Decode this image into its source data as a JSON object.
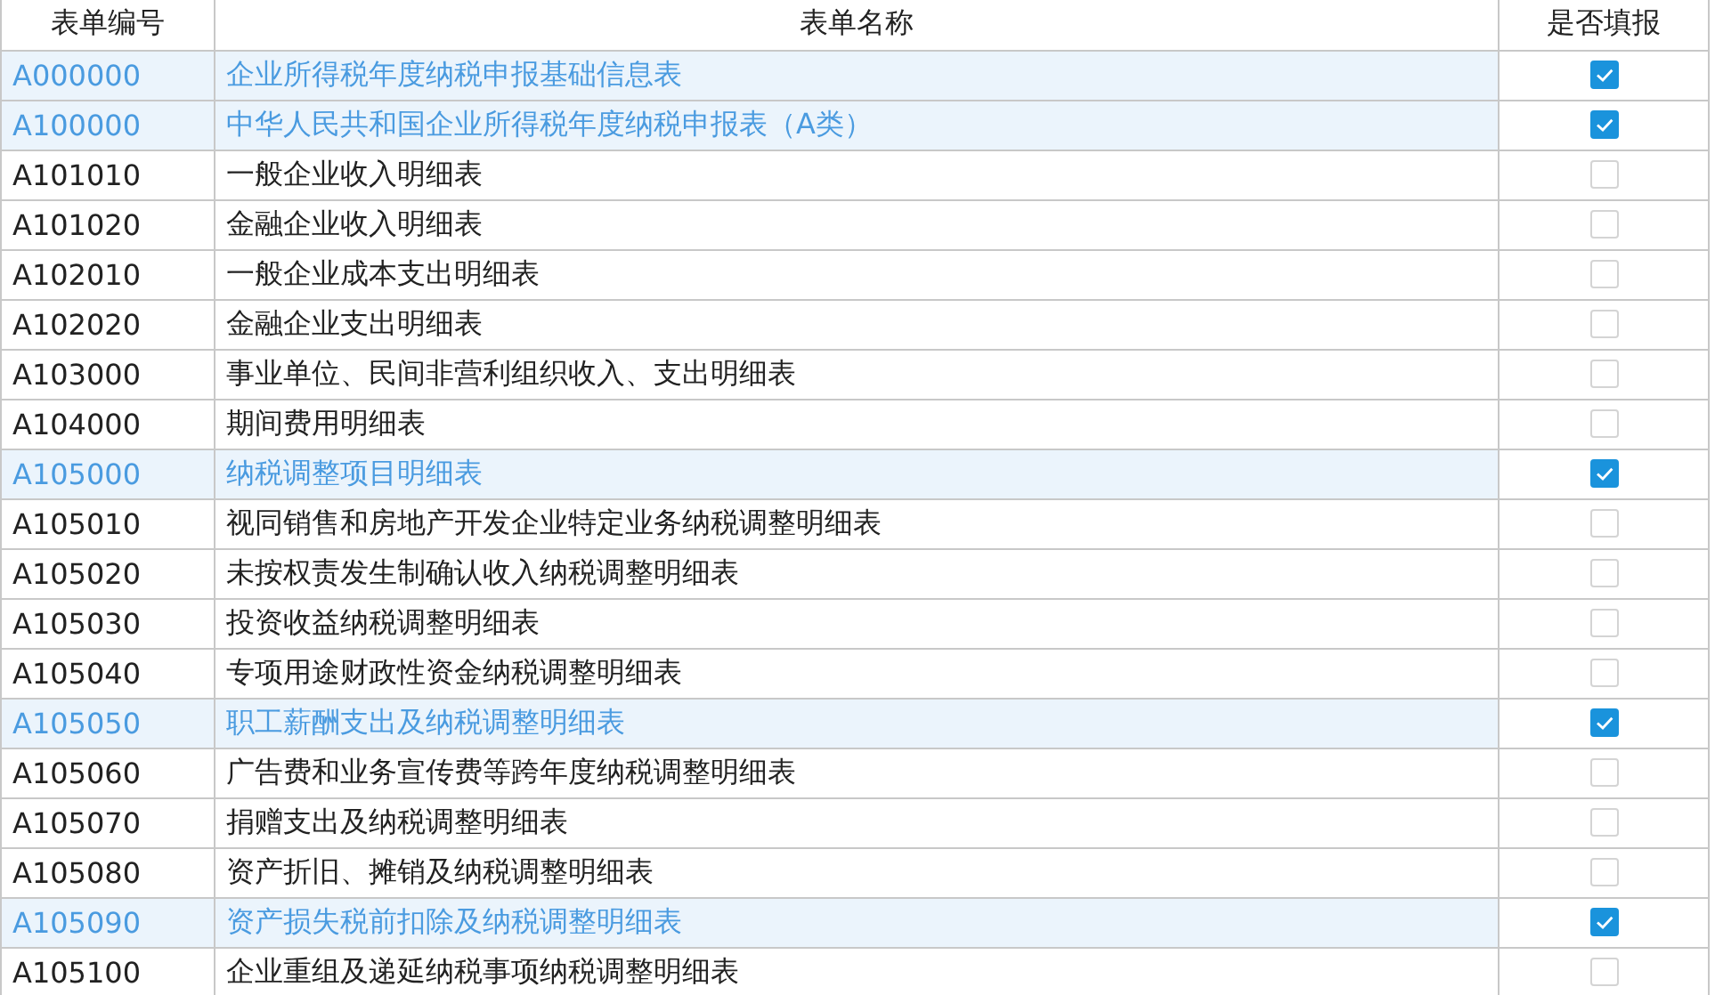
{
  "table": {
    "columns": [
      "表单编号",
      "表单名称",
      "是否填报"
    ],
    "rows": [
      {
        "code": "A000000",
        "name": "企业所得税年度纳税申报基础信息表",
        "checked": true
      },
      {
        "code": "A100000",
        "name": "中华人民共和国企业所得税年度纳税申报表（A类）",
        "checked": true
      },
      {
        "code": "A101010",
        "name": "一般企业收入明细表",
        "checked": false
      },
      {
        "code": "A101020",
        "name": "金融企业收入明细表",
        "checked": false
      },
      {
        "code": "A102010",
        "name": "一般企业成本支出明细表",
        "checked": false
      },
      {
        "code": "A102020",
        "name": "金融企业支出明细表",
        "checked": false
      },
      {
        "code": "A103000",
        "name": "事业单位、民间非营利组织收入、支出明细表",
        "checked": false
      },
      {
        "code": "A104000",
        "name": "期间费用明细表",
        "checked": false
      },
      {
        "code": "A105000",
        "name": "纳税调整项目明细表",
        "checked": true
      },
      {
        "code": "A105010",
        "name": "视同销售和房地产开发企业特定业务纳税调整明细表",
        "checked": false
      },
      {
        "code": "A105020",
        "name": "未按权责发生制确认收入纳税调整明细表",
        "checked": false
      },
      {
        "code": "A105030",
        "name": "投资收益纳税调整明细表",
        "checked": false
      },
      {
        "code": "A105040",
        "name": "专项用途财政性资金纳税调整明细表",
        "checked": false
      },
      {
        "code": "A105050",
        "name": "职工薪酬支出及纳税调整明细表",
        "checked": true
      },
      {
        "code": "A105060",
        "name": "广告费和业务宣传费等跨年度纳税调整明细表",
        "checked": false
      },
      {
        "code": "A105070",
        "name": "捐赠支出及纳税调整明细表",
        "checked": false
      },
      {
        "code": "A105080",
        "name": "资产折旧、摊销及纳税调整明细表",
        "checked": false
      },
      {
        "code": "A105090",
        "name": "资产损失税前扣除及纳税调整明细表",
        "checked": true
      },
      {
        "code": "A105100",
        "name": "企业重组及递延纳税事项纳税调整明细表",
        "checked": false
      }
    ]
  }
}
